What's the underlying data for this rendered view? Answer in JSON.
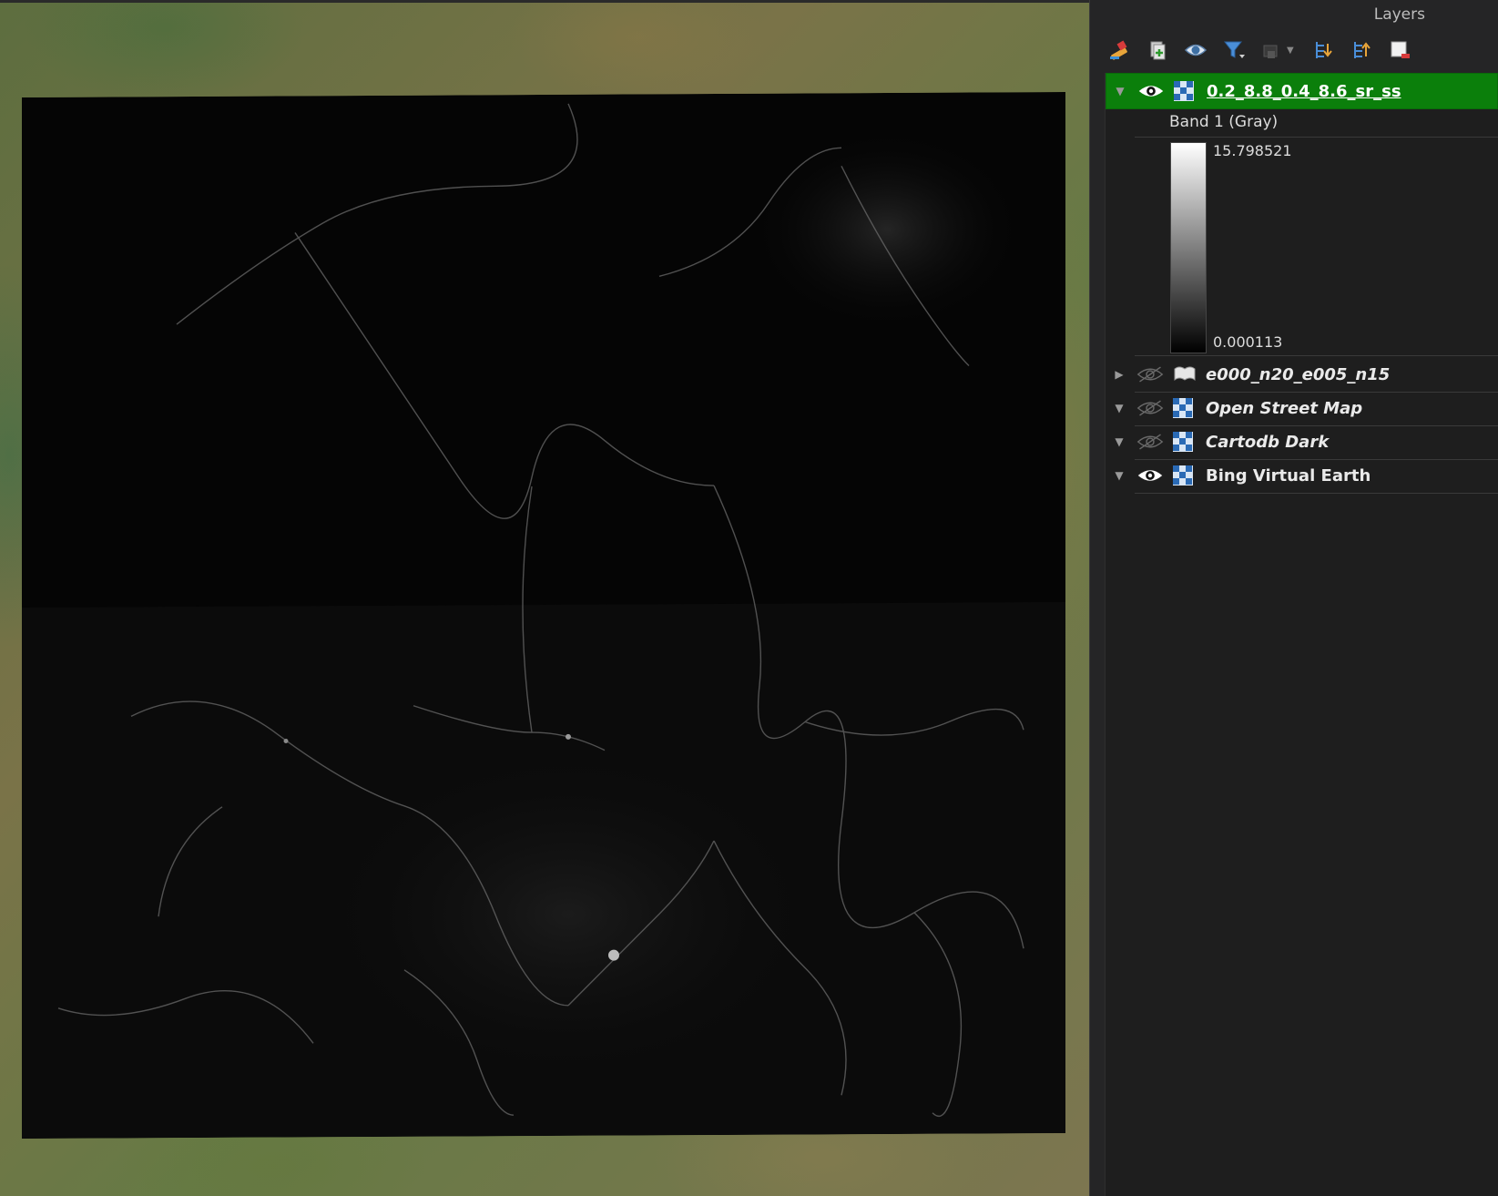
{
  "panel": {
    "title": "Layers",
    "toolbar": {
      "buttons": [
        {
          "name": "style-brush-icon"
        },
        {
          "name": "add-group-icon"
        },
        {
          "name": "visibility-eye-icon"
        },
        {
          "name": "filter-icon"
        },
        {
          "name": "expression-filter-icon"
        },
        {
          "name": "expand-all-icon"
        },
        {
          "name": "collapse-all-icon"
        },
        {
          "name": "remove-layer-icon"
        }
      ]
    }
  },
  "layers": [
    {
      "name": "0.2_8.8_0.4_8.6_sr_ss",
      "visible": true,
      "type": "raster",
      "selected": true,
      "expanded": true
    },
    {
      "name": "e000_n20_e005_n15",
      "visible": false,
      "type": "vector",
      "expanded": false
    },
    {
      "name": "Open Street Map",
      "visible": false,
      "type": "raster",
      "expanded": true
    },
    {
      "name": "Cartodb Dark",
      "visible": false,
      "type": "raster",
      "expanded": true
    },
    {
      "name": "Bing Virtual Earth",
      "visible": true,
      "type": "raster",
      "expanded": true
    }
  ],
  "legend": {
    "band": "Band 1 (Gray)",
    "max": "15.798521",
    "min": "0.000113"
  },
  "colors": {
    "selected_row": "#0b7f0b",
    "panel_bg": "#1e1e1e"
  }
}
